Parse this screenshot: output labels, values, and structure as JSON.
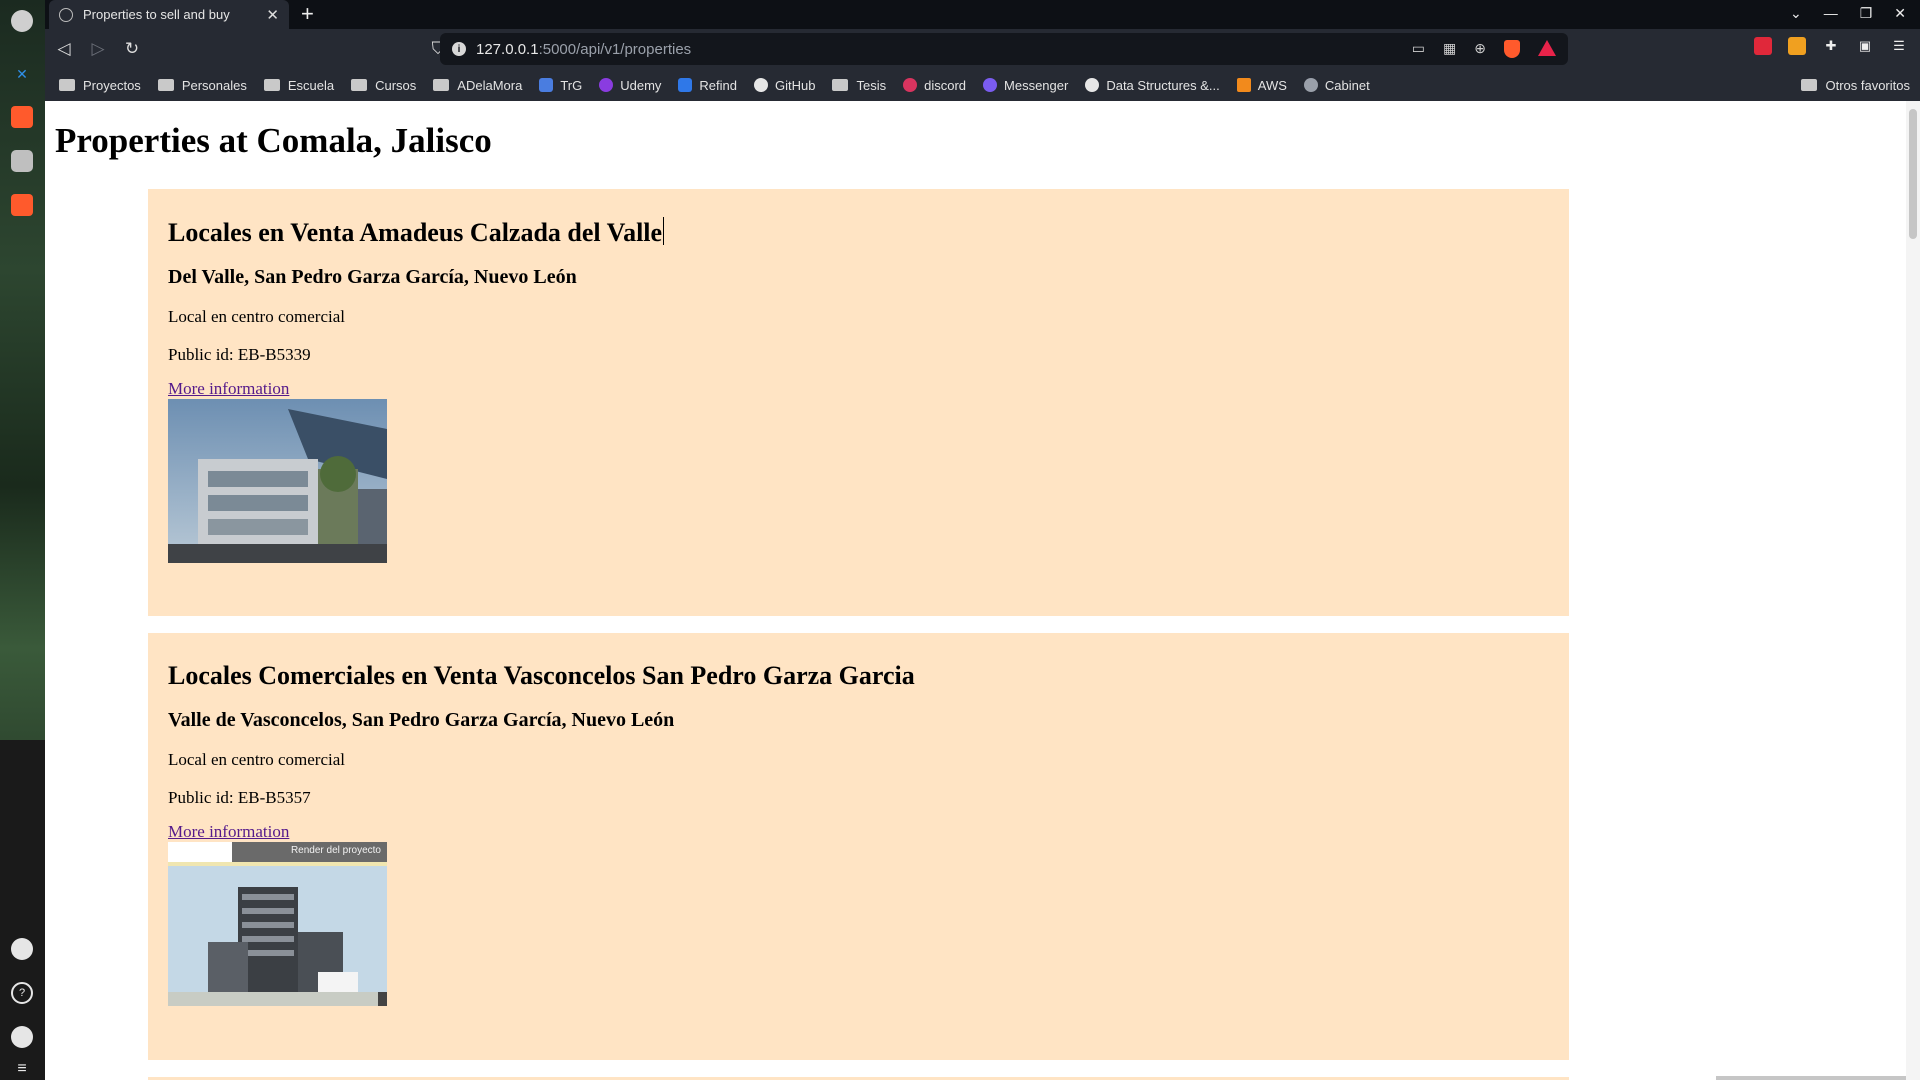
{
  "browser": {
    "tab_title": "Properties to sell and buy",
    "tab_close": "✕",
    "new_tab": "+",
    "url_host": "127.0.0.1",
    "url_path": ":5000/api/v1/properties",
    "window_controls": [
      "⌄",
      "—",
      "❐",
      "✕"
    ],
    "bookmarks": [
      {
        "label": "Proyectos",
        "icon": "folder"
      },
      {
        "label": "Personales",
        "icon": "folder"
      },
      {
        "label": "Escuela",
        "icon": "folder"
      },
      {
        "label": "Cursos",
        "icon": "folder"
      },
      {
        "label": "ADelaMora",
        "icon": "folder"
      },
      {
        "label": "TrG",
        "icon": "translate",
        "color": "#4a7de0"
      },
      {
        "label": "Udemy",
        "icon": "udemy",
        "color": "#8a3ce0"
      },
      {
        "label": "Refind",
        "icon": "refind",
        "color": "#2f78e8"
      },
      {
        "label": "GitHub",
        "icon": "github",
        "color": "#e6e6e6"
      },
      {
        "label": "Tesis",
        "icon": "folder"
      },
      {
        "label": "discord",
        "icon": "discord",
        "color": "#d8345f"
      },
      {
        "label": "Messenger",
        "icon": "messenger",
        "color": "#7a5cf0"
      },
      {
        "label": "Data Structures &...",
        "icon": "google",
        "color": "#e6e6e6"
      },
      {
        "label": "AWS",
        "icon": "aws",
        "color": "#f28a1c"
      },
      {
        "label": "Cabinet",
        "icon": "cabinet",
        "color": "#9aa0aa"
      }
    ],
    "other_bookmarks": "Otros favoritos"
  },
  "page": {
    "title": "Properties at Comala, Jalisco",
    "properties": [
      {
        "title": "Locales en Venta Amadeus Calzada del Valle",
        "location": "Del Valle, San Pedro Garza García, Nuevo León",
        "description": "Local en centro comercial",
        "public_id": "Public id: EB-B5339",
        "link": "More information"
      },
      {
        "title": "Locales Comerciales en Venta Vasconcelos San Pedro Garza Garcia",
        "location": "Valle de Vasconcelos, San Pedro Garza García, Nuevo León",
        "description": "Local en centro comercial",
        "public_id": "Public id: EB-B5357",
        "link": "More information",
        "image_caption": "Render del proyecto"
      }
    ]
  }
}
